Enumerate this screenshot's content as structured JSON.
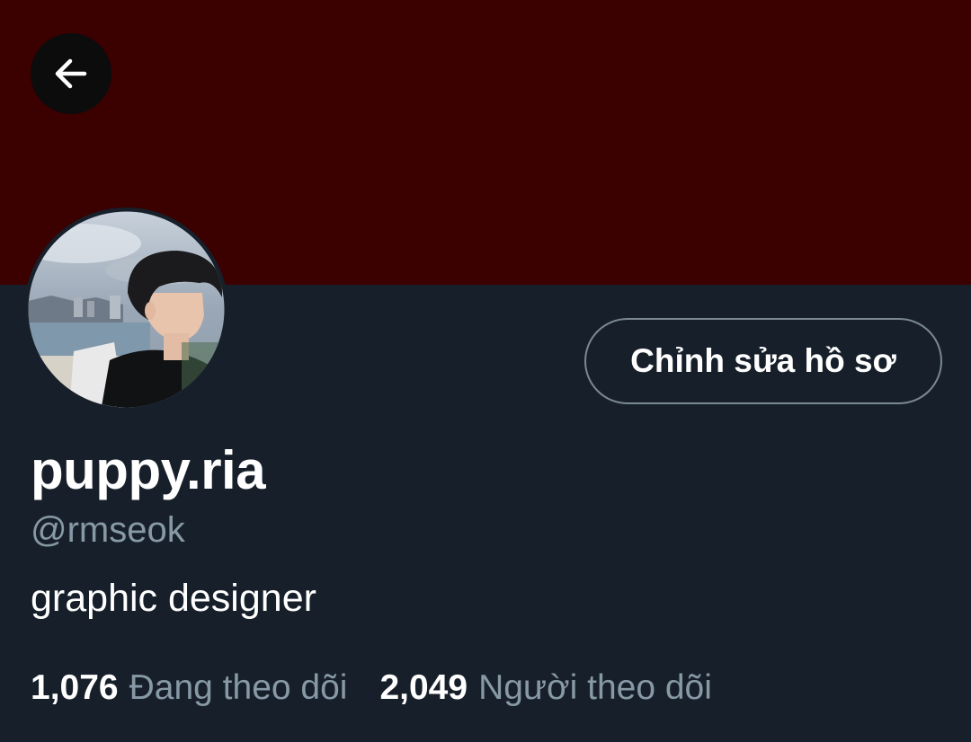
{
  "profile": {
    "display_name": "puppy.ria",
    "handle": "@rmseok",
    "bio": "graphic designer",
    "edit_profile_label": "Chỉnh sửa hồ sơ",
    "avatar_icon": "profile-photo",
    "back_icon": "arrow-left-icon"
  },
  "stats": {
    "following": {
      "count": "1,076",
      "label": "Đang theo dõi"
    },
    "followers": {
      "count": "2,049",
      "label": "Người theo dõi"
    }
  },
  "colors": {
    "banner": "#3b0000",
    "background": "#17202a",
    "secondary_text": "#8899a6",
    "button_border": "#7a8894"
  }
}
